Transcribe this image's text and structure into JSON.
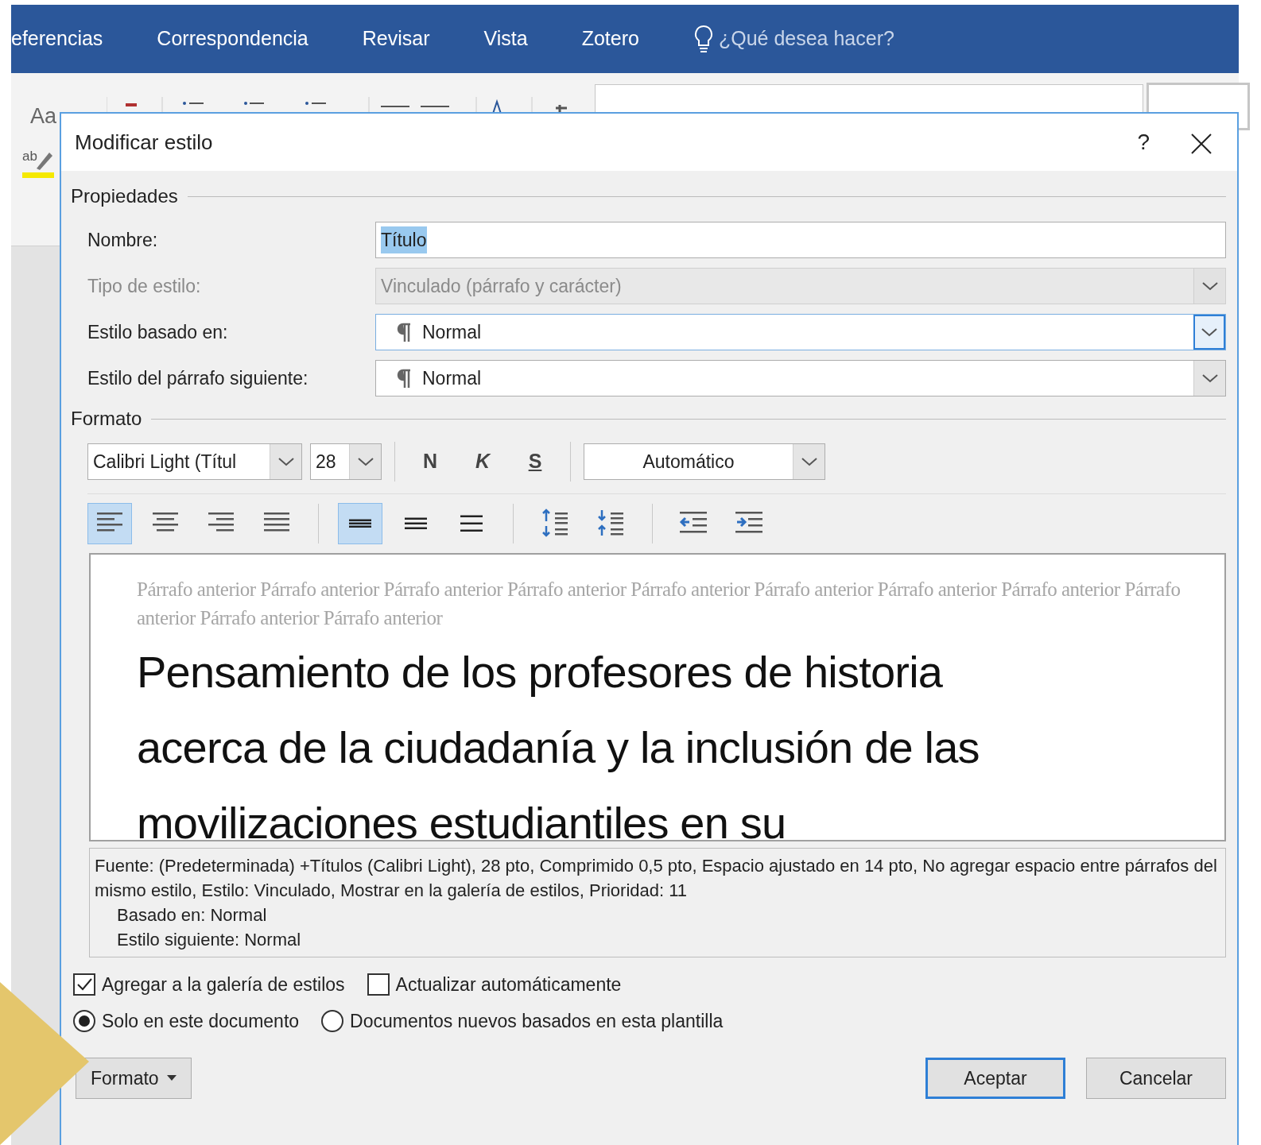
{
  "ribbon": {
    "tabs": [
      {
        "label": "eferencias"
      },
      {
        "label": "Correspondencia"
      },
      {
        "label": "Revisar"
      },
      {
        "label": "Vista"
      },
      {
        "label": "Zotero"
      }
    ],
    "search": {
      "placeholder": "¿Qué desea hacer?"
    },
    "font_sample": "Aa",
    "highlight_label": "ab"
  },
  "dialog": {
    "title": "Modificar estilo",
    "help": "?",
    "properties": {
      "heading": "Propiedades",
      "rows": [
        {
          "label": "Nombre:",
          "kind": "text",
          "value": "Título",
          "value_selected": true,
          "disabled": false,
          "focused": false
        },
        {
          "label": "Tipo de estilo:",
          "kind": "combo",
          "value": "Vinculado (párrafo y carácter)",
          "value_selected": false,
          "disabled": true,
          "focused": false
        },
        {
          "label": "Estilo basado en:",
          "kind": "style_combo",
          "value": "Normal",
          "value_selected": false,
          "disabled": false,
          "focused": true
        },
        {
          "label": "Estilo del párrafo siguiente:",
          "kind": "style_combo",
          "value": "Normal",
          "value_selected": false,
          "disabled": false,
          "focused": false
        }
      ]
    },
    "format": {
      "heading": "Formato",
      "font": "Calibri Light (Títul",
      "size": "28",
      "styles": [
        {
          "label": "N",
          "kind": "bold"
        },
        {
          "label": "K",
          "kind": "italic"
        },
        {
          "label": "S",
          "kind": "underline"
        }
      ],
      "font_color_choice": "Automático",
      "paragraph_buttons": [
        [
          {
            "kind": "align_left",
            "selected": true
          },
          {
            "kind": "align_center",
            "selected": false
          },
          {
            "kind": "align_right",
            "selected": false
          },
          {
            "kind": "justify",
            "selected": false
          }
        ],
        [
          {
            "kind": "spacing_single",
            "selected": true
          },
          {
            "kind": "spacing_one_half",
            "selected": false
          },
          {
            "kind": "spacing_double",
            "selected": false
          }
        ],
        [
          {
            "kind": "space_before_increase",
            "selected": false
          },
          {
            "kind": "space_before_decrease",
            "selected": false
          }
        ],
        [
          {
            "kind": "indent_decrease",
            "selected": false
          },
          {
            "kind": "indent_increase",
            "selected": false
          }
        ]
      ]
    },
    "preview": {
      "previous_paragraph": "Párrafo anterior Párrafo anterior Párrafo anterior Párrafo anterior Párrafo anterior Párrafo anterior Párrafo anterior Párrafo anterior Párrafo anterior Párrafo anterior Párrafo anterior",
      "sample_lines": [
        "Pensamiento de los profesores de historia",
        "acerca de la ciudadanía y la inclusión de las",
        "movilizaciones estudiantiles en su"
      ]
    },
    "description": {
      "text": "Fuente: (Predeterminada) +Títulos (Calibri Light), 28 pto, Comprimido  0,5 pto, Espacio ajustado en 14 pto, No agregar espacio entre párrafos del mismo estilo, Estilo: Vinculado, Mostrar en la galería de estilos, Prioridad: 11",
      "details": [
        "Basado en: Normal",
        "Estilo siguiente: Normal"
      ]
    },
    "checkboxes": [
      {
        "label": "Agregar a la galería de estilos",
        "checked": true
      },
      {
        "label": "Actualizar automáticamente",
        "checked": false
      }
    ],
    "radios": [
      {
        "label": "Solo en este documento",
        "selected": true
      },
      {
        "label": "Documentos nuevos basados en esta plantilla",
        "selected": false
      }
    ],
    "format_button": "Formato",
    "buttons": [
      {
        "label": "Aceptar",
        "default": true
      },
      {
        "label": "Cancelar",
        "default": false
      }
    ]
  }
}
